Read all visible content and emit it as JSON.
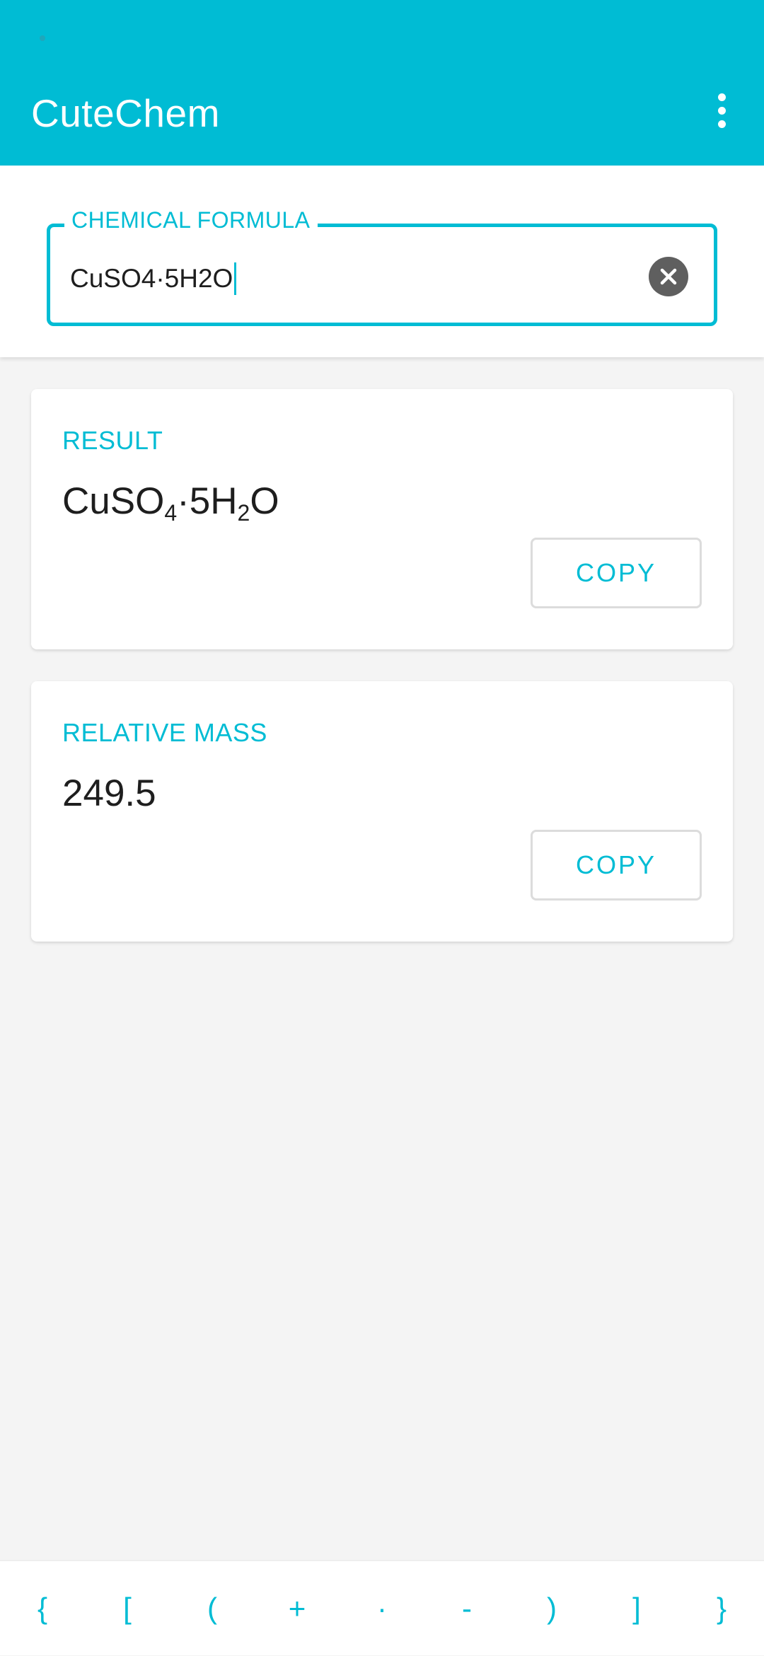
{
  "app": {
    "title": "CuteChem"
  },
  "input": {
    "label": "CHEMICAL FORMULA",
    "value": "CuSO4·5H2O"
  },
  "result_card": {
    "label": "RESULT",
    "formula_parts": {
      "p1": "CuSO",
      "sub1": "4",
      "p2": "·5H",
      "sub2": "2",
      "p3": "O"
    },
    "copy_label": "COPY"
  },
  "mass_card": {
    "label": "RELATIVE MASS",
    "value": "249.5",
    "copy_label": "COPY"
  },
  "symbol_keys": [
    "{",
    "[",
    "(",
    "+",
    "·",
    "-",
    ")",
    "]",
    "}"
  ],
  "colors": {
    "primary": "#00bcd4",
    "background": "#f4f4f4",
    "text": "#1e1e1e",
    "clear_icon": "#5f5f5f"
  },
  "icons": {
    "menu": "more-vert-icon",
    "clear": "close-circle-icon"
  }
}
